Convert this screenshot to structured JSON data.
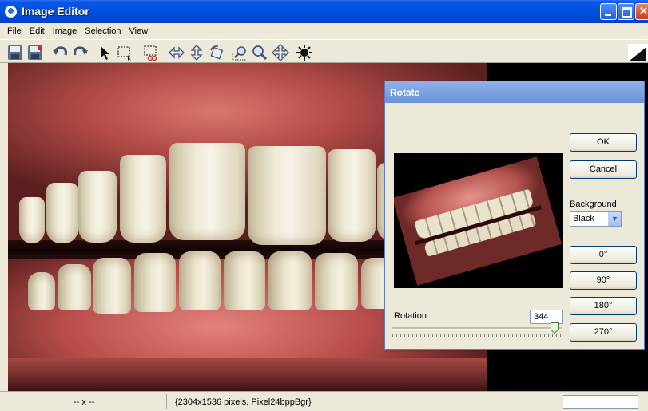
{
  "window": {
    "title": "Image Editor"
  },
  "menu": {
    "items": [
      "File",
      "Edit",
      "Image",
      "Selection",
      "View"
    ]
  },
  "toolbar": {
    "tools": [
      "save-icon",
      "save-as-icon",
      "undo-icon",
      "redo-icon",
      "pointer-icon",
      "select-rectangle-icon",
      "crop-icon",
      "flip-horizontal-icon",
      "flip-vertical-icon",
      "rotate-icon",
      "zoom-in-icon",
      "zoom-out-icon",
      "pan-icon",
      "brightness-icon"
    ]
  },
  "status": {
    "coords": "-- x --",
    "info": "{2304x1536 pixels, Pixel24bppBgr}"
  },
  "rotate_dialog": {
    "title": "Rotate",
    "ok": "OK",
    "cancel": "Cancel",
    "background_label": "Background",
    "background_value": "Black",
    "presets": [
      "0°",
      "90°",
      "180°",
      "270°"
    ],
    "rotation_label": "Rotation",
    "rotation_value": "344",
    "slider_fraction": 0.956
  },
  "colors": {
    "title_blue": "#0051e2",
    "dialog_title": "#7da2e0",
    "face": "#ece9d8"
  }
}
